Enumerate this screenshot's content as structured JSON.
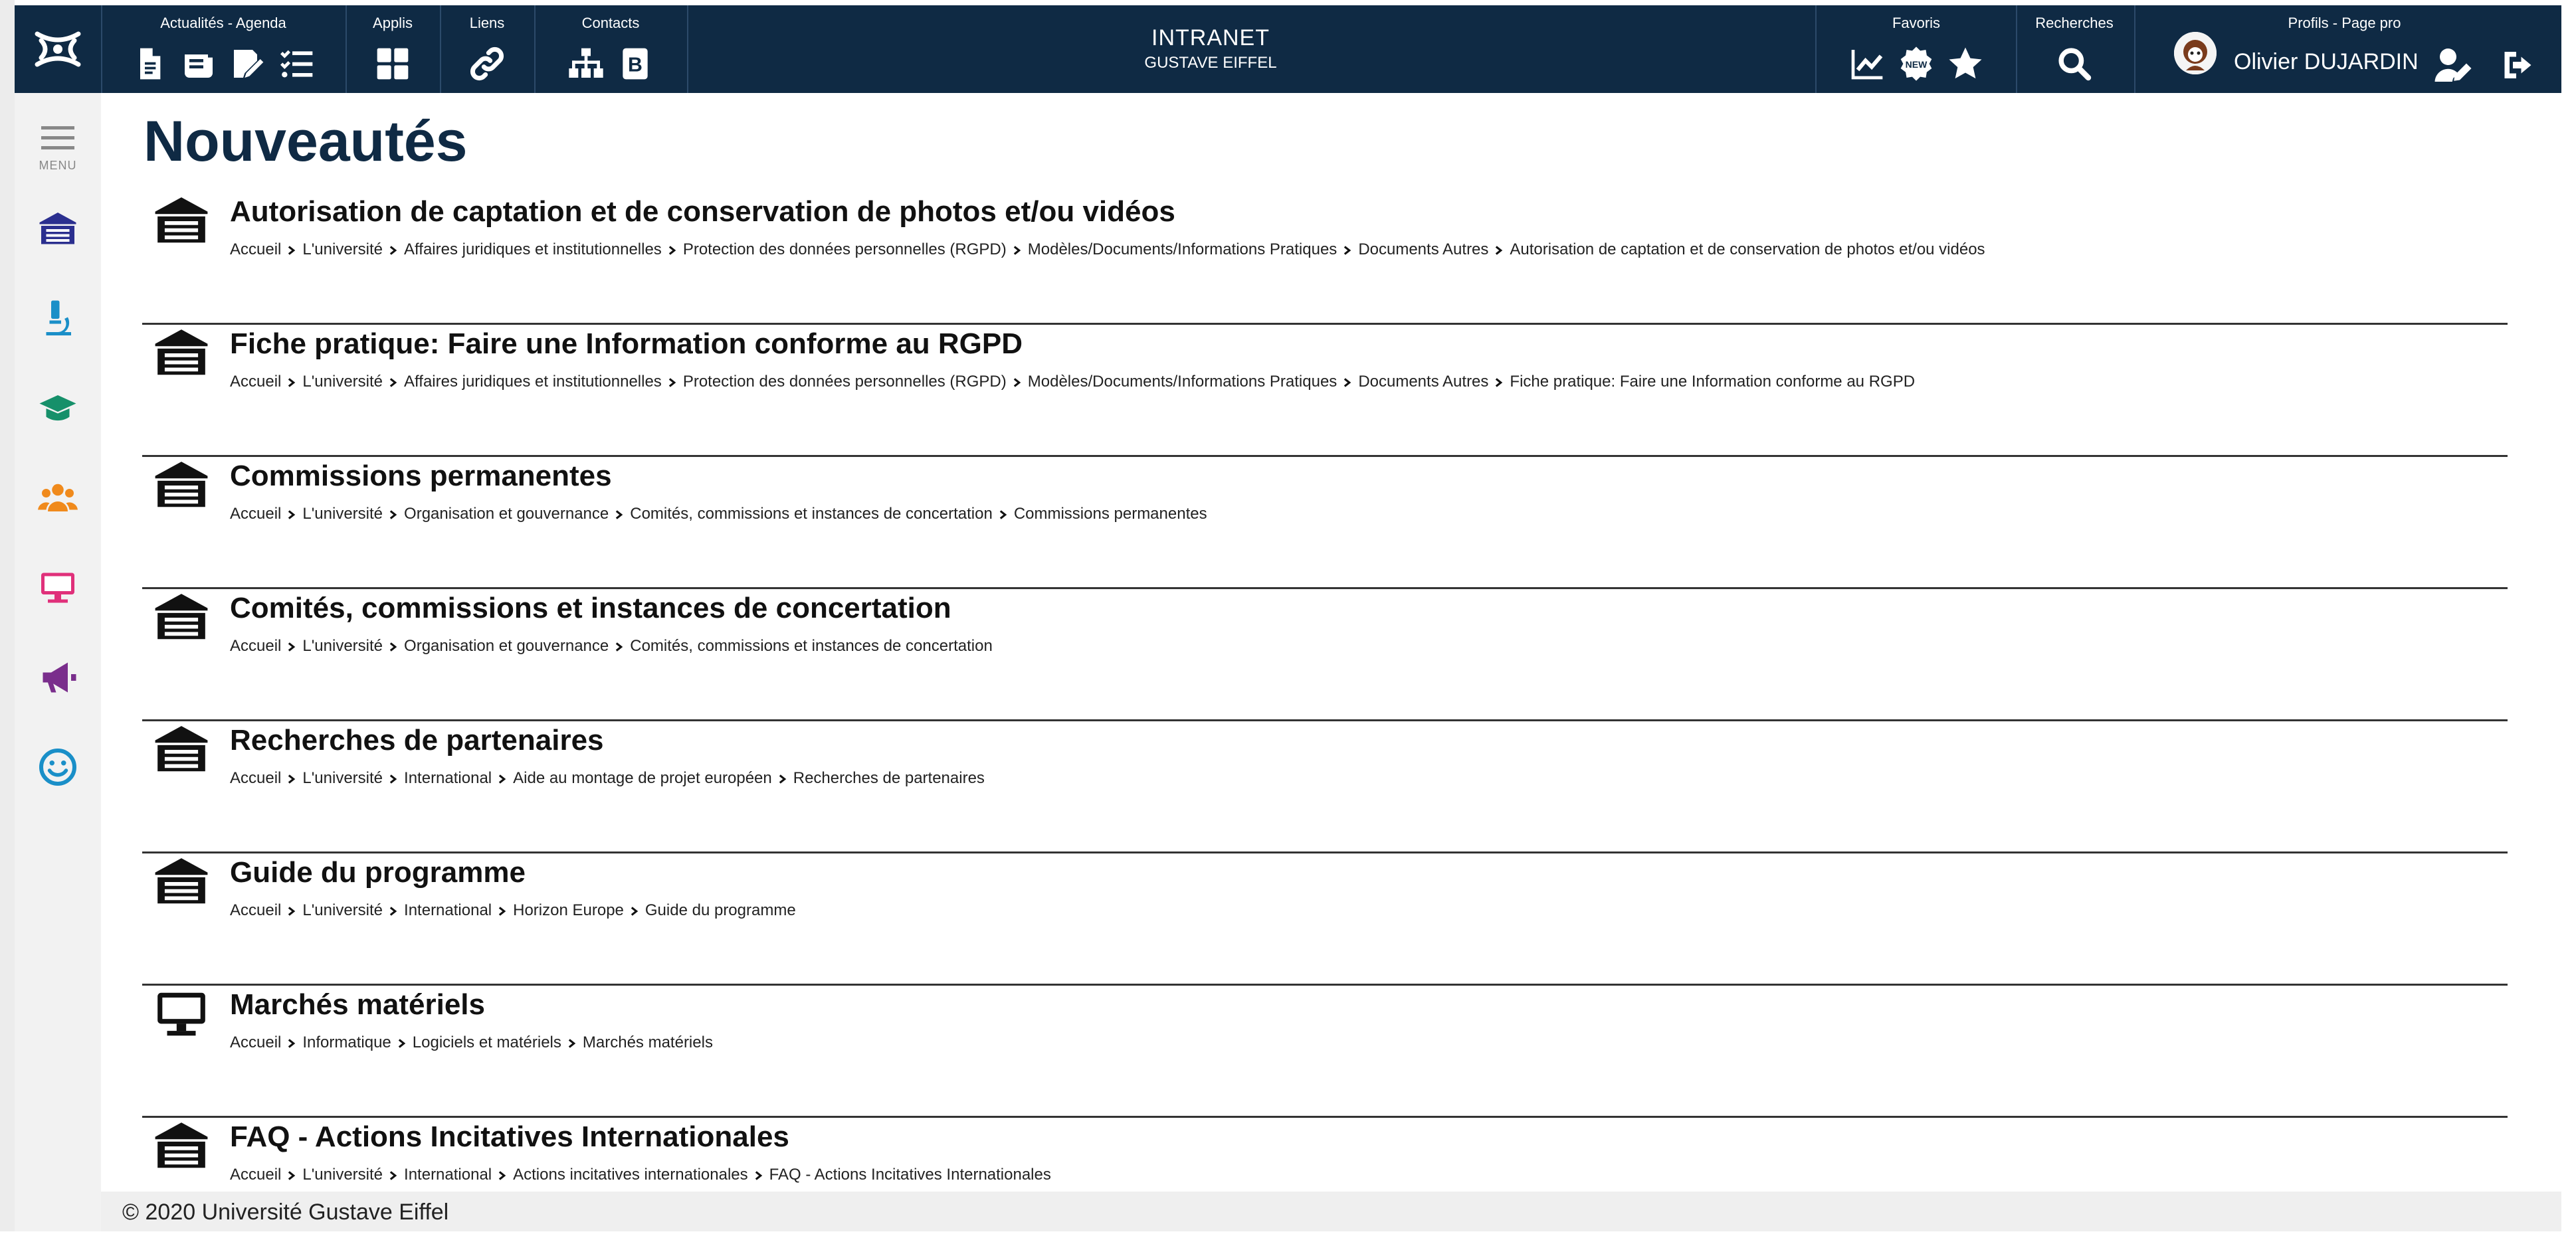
{
  "topbar": {
    "groups": [
      {
        "label": "Actualités - Agenda"
      },
      {
        "label": "Applis"
      },
      {
        "label": "Liens"
      },
      {
        "label": "Contacts"
      },
      {
        "label": "Favoris"
      },
      {
        "label": "Recherches"
      },
      {
        "label": "Profils - Page pro"
      }
    ],
    "title_line1": "INTRANET",
    "title_line2": "GUSTAVE EIFFEL",
    "user_name": "Olivier DUJARDIN",
    "new_badge": "NEW"
  },
  "sidebar": {
    "menu_label": "MENU",
    "icon_colors": {
      "university": "#2b2f8f",
      "research": "#1a8fc8",
      "education": "#16906a",
      "people": "#f08a1c",
      "computer": "#e0307a",
      "announce": "#7a2e8c",
      "smile": "#1a8fc8"
    }
  },
  "main": {
    "title": "Nouveautés",
    "items": [
      {
        "icon": "university-icon",
        "title": "Autorisation de captation et de conservation de photos et/ou vidéos",
        "crumbs": [
          "Accueil",
          "L'université",
          "Affaires juridiques et institutionnelles",
          "Protection des données personnelles (RGPD)",
          "Modèles/Documents/Informations Pratiques",
          "Documents Autres",
          "Autorisation de captation et de conservation de photos et/ou vidéos"
        ]
      },
      {
        "icon": "university-icon",
        "title": "Fiche pratique: Faire une Information conforme au RGPD",
        "crumbs": [
          "Accueil",
          "L'université",
          "Affaires juridiques et institutionnelles",
          "Protection des données personnelles (RGPD)",
          "Modèles/Documents/Informations Pratiques",
          "Documents Autres",
          "Fiche pratique: Faire une Information conforme au RGPD"
        ]
      },
      {
        "icon": "university-icon",
        "title": "Commissions permanentes",
        "crumbs": [
          "Accueil",
          "L'université",
          "Organisation et gouvernance",
          "Comités, commissions et instances de concertation",
          "Commissions permanentes"
        ]
      },
      {
        "icon": "university-icon",
        "title": "Comités, commissions et instances de concertation",
        "crumbs": [
          "Accueil",
          "L'université",
          "Organisation et gouvernance",
          "Comités, commissions et instances de concertation"
        ]
      },
      {
        "icon": "university-icon",
        "title": "Recherches de partenaires",
        "crumbs": [
          "Accueil",
          "L'université",
          "International",
          "Aide au montage de projet européen",
          "Recherches de partenaires"
        ]
      },
      {
        "icon": "university-icon",
        "title": "Guide du programme",
        "crumbs": [
          "Accueil",
          "L'université",
          "International",
          "Horizon Europe",
          "Guide du programme"
        ]
      },
      {
        "icon": "computer-icon",
        "title": "Marchés matériels",
        "crumbs": [
          "Accueil",
          "Informatique",
          "Logiciels et matériels",
          "Marchés matériels"
        ]
      },
      {
        "icon": "university-icon",
        "title": "FAQ - Actions Incitatives Internationales",
        "crumbs": [
          "Accueil",
          "L'université",
          "International",
          "Actions incitatives internationales",
          "FAQ - Actions Incitatives Internationales"
        ]
      }
    ]
  },
  "footer": {
    "text": "© 2020 Université Gustave Eiffel"
  }
}
